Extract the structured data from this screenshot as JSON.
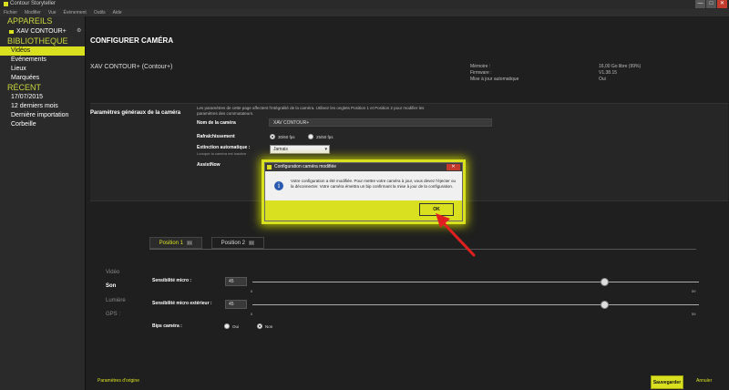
{
  "window": {
    "title": "Contour Storyteller",
    "controls": {
      "minimize": "—",
      "maximize": "□",
      "close": "✕"
    }
  },
  "menu": [
    "Fichier",
    "Modifier",
    "Vue",
    "Évènement",
    "Outils",
    "Aide"
  ],
  "sidebar": {
    "devices_header": "APPAREILS",
    "device_name": "XAV CONTOUR+",
    "library_header": "BIBLIOTHEQUE",
    "library_items": [
      "Vidéos",
      "Evénements",
      "Lieux",
      "Marquées"
    ],
    "recent_header": "RÉCENT",
    "recent_items": [
      "17/07/2015",
      "12 derniers mois",
      "Dernière importation",
      "Corbeille"
    ]
  },
  "main": {
    "page_title": "CONFIGURER CAMÉRA",
    "camera_label": "XAV CONTOUR+ (Contour+)",
    "info": [
      {
        "label": "Mémoire :",
        "value": "16,00 Go libre (99%)"
      },
      {
        "label": "Firmware :",
        "value": "V1.38.15"
      },
      {
        "label": "Mise à jour automatique",
        "value": "Oui"
      }
    ],
    "panel_title": "Paramètres généraux de la caméra",
    "panel_desc": "Les paramètres de cette page affectent l'intégralité de la caméra. Utilisez les onglets Position 1 et Position 2 pour modifier les paramètres des commutateurs.",
    "camera_name_label": "Nom de la caméra",
    "camera_name_value": "XAV CONTOUR+",
    "refresh_label": "Rafraîchissement",
    "refresh_opt1": "30/60 fps",
    "refresh_opt2": "25/50 fps",
    "auto_off_label": "Extinction automatique :",
    "auto_off_sub": "Lorsque la caméra est inactive",
    "auto_off_value": "Jamais",
    "assist_label": "AssistNow",
    "tabs": [
      {
        "label": "Position 1",
        "badge": "≡↕"
      },
      {
        "label": "Position 2",
        "badge": "≡↕"
      }
    ],
    "vertical_tabs": [
      "Vidéo",
      "Son",
      "Lumière",
      "GPS :"
    ],
    "mic_label": "Sensibilité micro :",
    "mic_value": "45",
    "ext_mic_label": "Sensibilité micro extérieur :",
    "ext_mic_value": "45",
    "slider_min": "0",
    "slider_max": "59",
    "beep_label": "Bips caméra :",
    "beep_yes": "Oui",
    "beep_no": "Non"
  },
  "levels": {
    "mic_sensitivity": 45,
    "ext_mic_sensitivity": 45,
    "slider_range": [
      0,
      59
    ]
  },
  "footer": {
    "reset_label": "Paramètres d'origine",
    "save_label": "Sauvegarder",
    "cancel_label": "Annuler"
  },
  "dialog": {
    "title": "Configuration caméra modifiée",
    "message": "Votre configuration a été modifiée. Pour mettre votre caméra à jour, vous devez l'éjecter ou la déconnecter. Votre caméra émettra un bip confirmant la mise à jour de la configuration.",
    "ok_label": "OK",
    "close": "✕",
    "icon_glyph": "i"
  },
  "colors": {
    "accent": "#d8e020",
    "background": "#1f1f1f",
    "sidebar": "#2a2a2a",
    "arrow": "#e02020"
  }
}
